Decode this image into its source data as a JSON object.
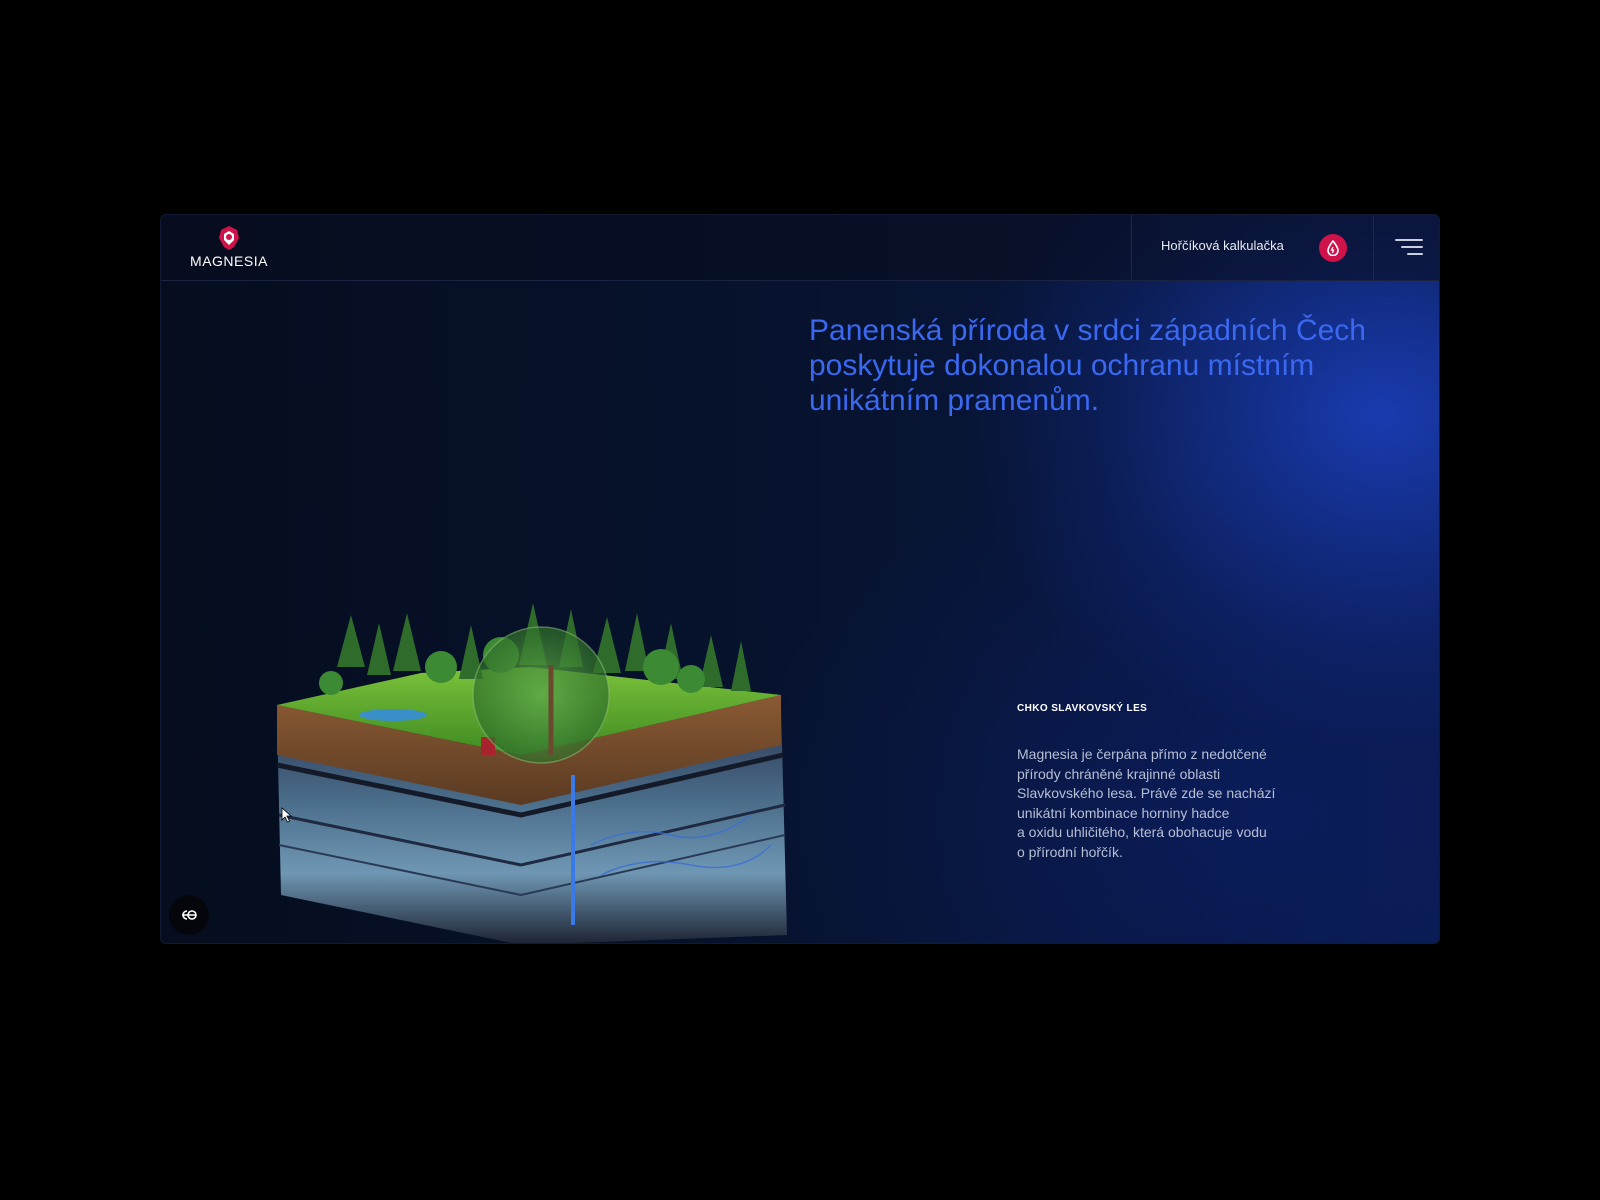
{
  "header": {
    "logo_text": "MAGNESIA",
    "calculator_label": "Hořčíková kalkulačka",
    "calculator_icon": "magnesium-drop-icon",
    "menu_icon": "hamburger-menu-icon"
  },
  "hero": {
    "headline": "Panenská příroda v srdci západních Čech poskytuje dokonalou ochranu místním unikátním pramenům."
  },
  "info": {
    "label": "CHKO SLAVKOVSKÝ LES",
    "body": "Magnesia je čerpána přímo z nedotčené\npřírody chráněné krajinné oblasti\nSlavkovského lesa. Právě zde se nachází\nunikátní kombinace horniny hadce\na oxidu uhličitého, která obohacuje vodu\no přírodní hořčík."
  },
  "colors": {
    "accent_blue": "#3a68f0",
    "brand_red": "#d0124b",
    "background": "#050d1e"
  },
  "accessibility": {
    "icon": "accessibility-toggle-icon"
  }
}
